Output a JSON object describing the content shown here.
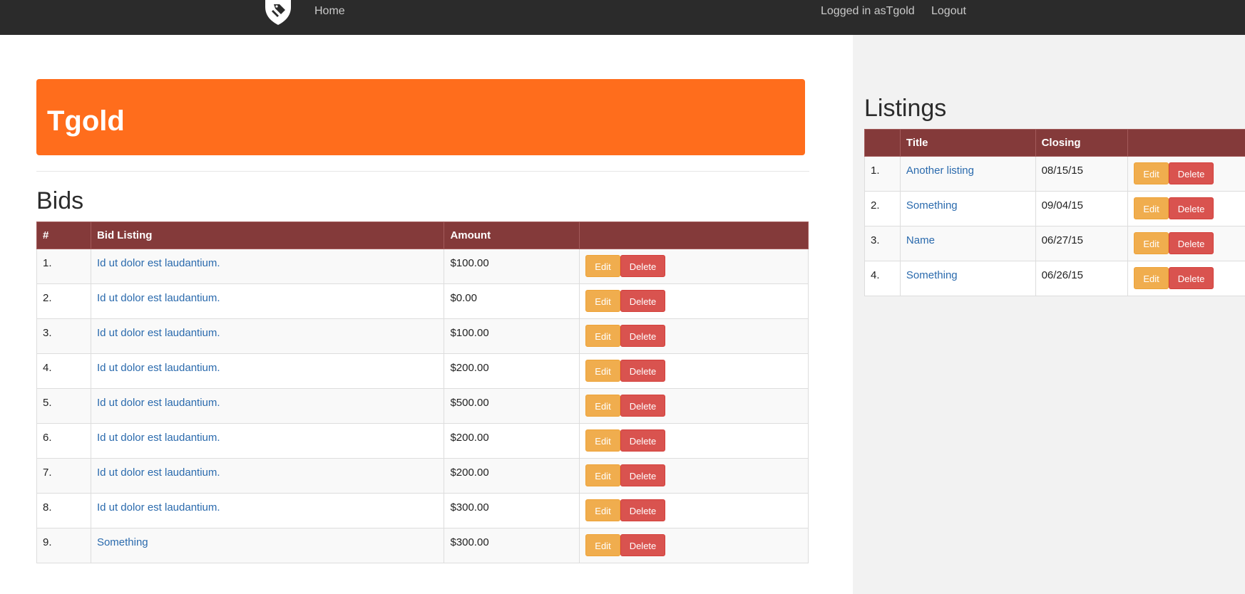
{
  "navbar": {
    "home_label": "Home",
    "logged_in_label": "Logged in asTgold",
    "logout_label": "Logout",
    "logo_icon": "shield-tag-icon"
  },
  "profile": {
    "username": "Tgold"
  },
  "colors": {
    "navbar_bg": "#2b2b2b",
    "banner_bg": "#ff6d1c",
    "table_header_bg": "#843a3a",
    "edit_btn": "#f0ad4e",
    "delete_btn": "#d9534f",
    "link": "#2a6aad",
    "sidebar_bg": "#f2f2f2"
  },
  "bids": {
    "title": "Bids",
    "columns": [
      "#",
      "Bid Listing",
      "Amount",
      ""
    ],
    "rows": [
      {
        "num": "1.",
        "listing": "Id ut dolor est laudantium.",
        "amount": "$100.00",
        "edit": "Edit",
        "delete": "Delete"
      },
      {
        "num": "2.",
        "listing": "Id ut dolor est laudantium.",
        "amount": "$0.00",
        "edit": "Edit",
        "delete": "Delete"
      },
      {
        "num": "3.",
        "listing": "Id ut dolor est laudantium.",
        "amount": "$100.00",
        "edit": "Edit",
        "delete": "Delete"
      },
      {
        "num": "4.",
        "listing": "Id ut dolor est laudantium.",
        "amount": "$200.00",
        "edit": "Edit",
        "delete": "Delete"
      },
      {
        "num": "5.",
        "listing": "Id ut dolor est laudantium.",
        "amount": "$500.00",
        "edit": "Edit",
        "delete": "Delete"
      },
      {
        "num": "6.",
        "listing": "Id ut dolor est laudantium.",
        "amount": "$200.00",
        "edit": "Edit",
        "delete": "Delete"
      },
      {
        "num": "7.",
        "listing": "Id ut dolor est laudantium.",
        "amount": "$200.00",
        "edit": "Edit",
        "delete": "Delete"
      },
      {
        "num": "8.",
        "listing": "Id ut dolor est laudantium.",
        "amount": "$300.00",
        "edit": "Edit",
        "delete": "Delete"
      },
      {
        "num": "9.",
        "listing": "Something",
        "amount": "$300.00",
        "edit": "Edit",
        "delete": "Delete"
      }
    ]
  },
  "listings": {
    "title": "Listings",
    "columns": [
      "",
      "Title",
      "Closing",
      ""
    ],
    "rows": [
      {
        "num": "1.",
        "title": "Another listing",
        "closing": "08/15/15",
        "edit": "Edit",
        "delete": "Delete"
      },
      {
        "num": "2.",
        "title": "Something",
        "closing": "09/04/15",
        "edit": "Edit",
        "delete": "Delete"
      },
      {
        "num": "3.",
        "title": "Name",
        "closing": "06/27/15",
        "edit": "Edit",
        "delete": "Delete"
      },
      {
        "num": "4.",
        "title": "Something",
        "closing": "06/26/15",
        "edit": "Edit",
        "delete": "Delete"
      }
    ]
  }
}
